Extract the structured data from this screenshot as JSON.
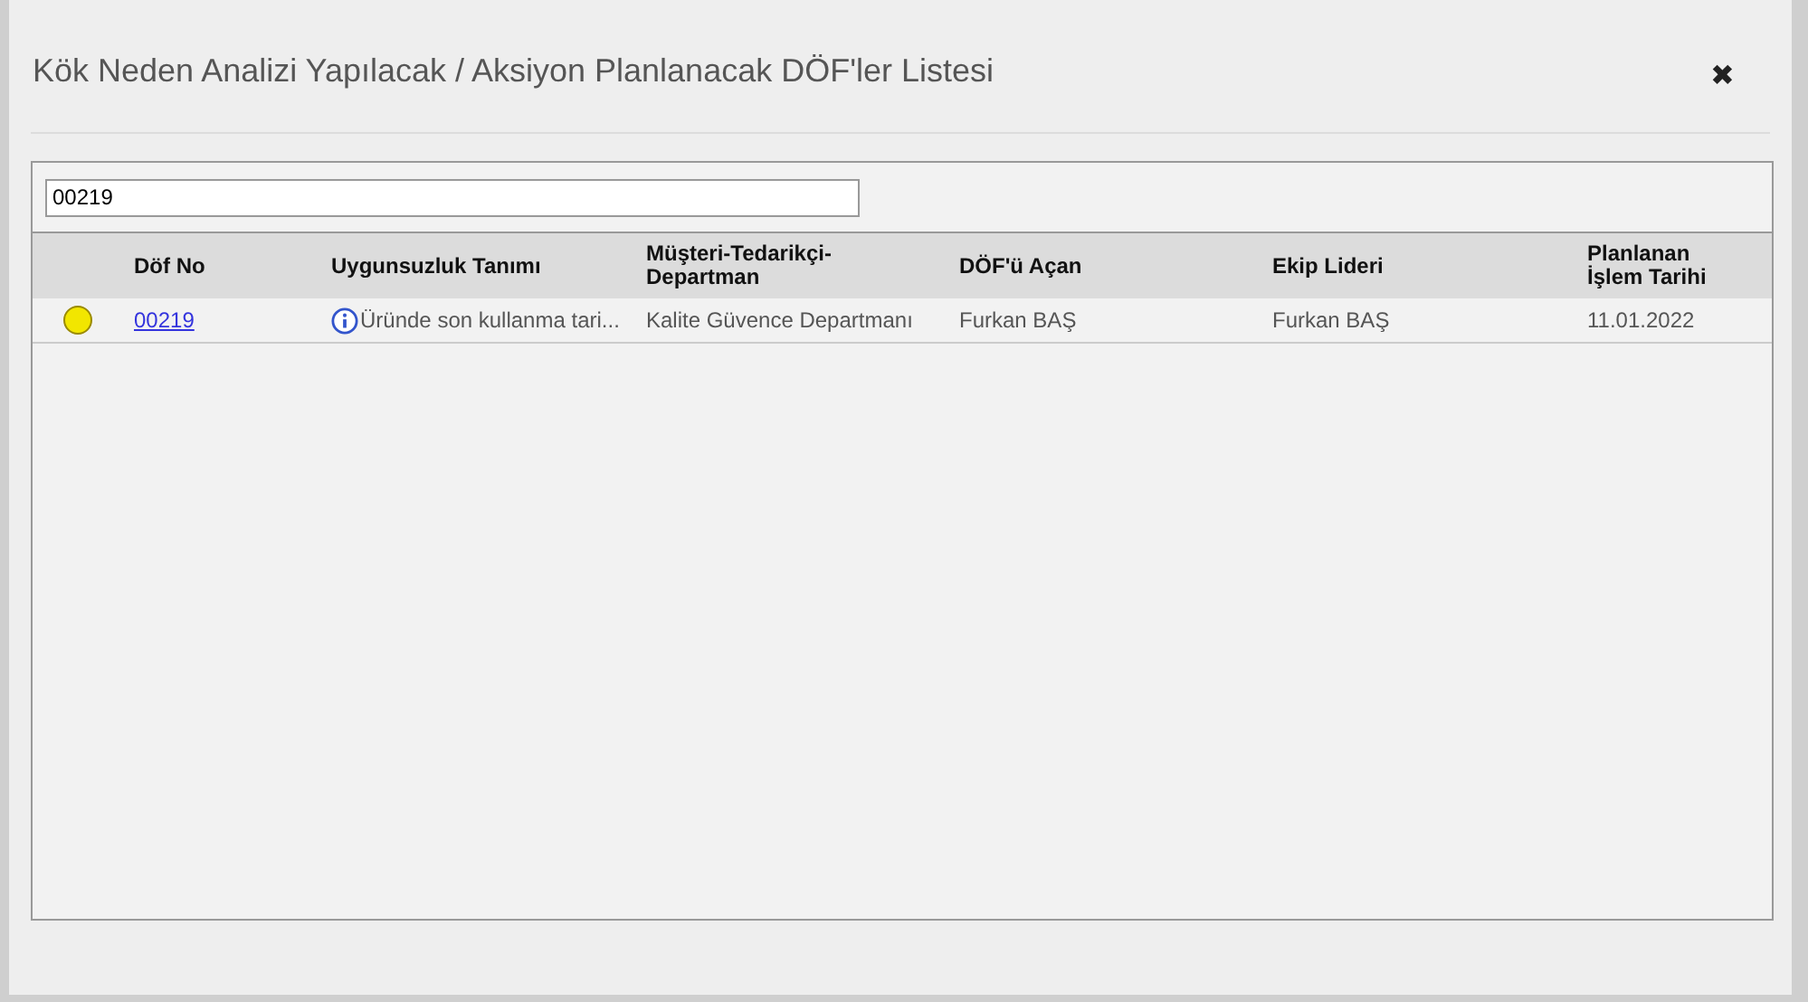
{
  "dialog": {
    "title": "Kök Neden Analizi Yapılacak / Aksiyon Planlanacak DÖF'ler Listesi",
    "close": "✖"
  },
  "search": {
    "value": "00219"
  },
  "table": {
    "columns": [
      "",
      "Döf No",
      "Uygunsuzluk Tanımı",
      "Müşteri-Tedarikçi-Departman",
      "DÖF'ü Açan",
      "Ekip Lideri",
      "Planlanan İşlem Tarihi"
    ],
    "rows": [
      {
        "color": "#f2e600",
        "dof_no": "00219",
        "description": "Üründe son kullanma tari...",
        "department": "Kalite Güvence Departmanı",
        "opened_by": "Furkan BAŞ",
        "team_leader": "Furkan BAŞ",
        "planned_date": "11.01.2022"
      }
    ]
  }
}
